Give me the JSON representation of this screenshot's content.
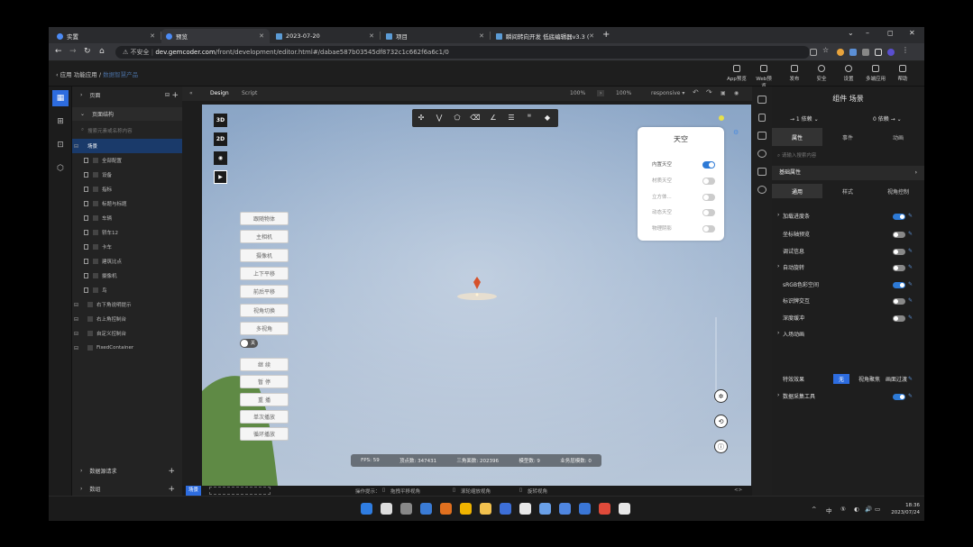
{
  "browser": {
    "tabs": [
      {
        "title": "实置",
        "fav": "#4c8bf5"
      },
      {
        "title": "预览",
        "fav": "#4c8bf5"
      },
      {
        "title": "2023-07-20",
        "fav": "#5b9bd5"
      },
      {
        "title": "项目",
        "fav": "#5b9bd5"
      },
      {
        "title": "瞬间转向开发 低底编辑器v3.3 (",
        "fav": "#5b9bd5"
      }
    ],
    "tab_close": "✕",
    "new_tab": "+",
    "window_controls": [
      "⌄",
      "–",
      "◻",
      "✕"
    ],
    "security_label": "不安全",
    "url_domain": "dev.gemcoder.com",
    "url_path": "/front/development/editor.html#/dabae587b03545df8732c1c662f6a6c1/0"
  },
  "app": {
    "breadcrumb_back": "‹ 应用",
    "breadcrumb_app": "功能应用",
    "breadcrumb_sep": "/",
    "breadcrumb_current": "数据智慧产品",
    "toolbar": [
      "App预览",
      "Web预览",
      "发布",
      "安全",
      "设置",
      "多端应用",
      "帮助"
    ]
  },
  "left_panel": {
    "page_label": "页面",
    "structure_label": "页面结构",
    "search_placeholder": "搜索元素或名称内容",
    "tree": [
      {
        "label": "场景",
        "selected": true,
        "kind": "root"
      },
      {
        "label": "全部配置",
        "selected": false,
        "kind": "doc"
      },
      {
        "label": "设备",
        "selected": false,
        "kind": "doc"
      },
      {
        "label": "指标",
        "selected": false,
        "kind": "doc"
      },
      {
        "label": "标题与标题",
        "selected": false,
        "kind": "doc"
      },
      {
        "label": "车辆",
        "selected": false,
        "kind": "doc"
      },
      {
        "label": "轿车12",
        "selected": false,
        "kind": "doc"
      },
      {
        "label": "卡车",
        "selected": false,
        "kind": "doc"
      },
      {
        "label": "建筑比点",
        "selected": false,
        "kind": "doc"
      },
      {
        "label": "摄像机",
        "selected": false,
        "kind": "doc"
      },
      {
        "label": "鸟",
        "selected": false,
        "kind": "doc"
      },
      {
        "label": "右下角说明提示",
        "selected": false,
        "kind": "group"
      },
      {
        "label": "右上角控制台",
        "selected": false,
        "kind": "group"
      },
      {
        "label": "自定义控制台",
        "selected": false,
        "kind": "group"
      },
      {
        "label": "FixedContainer",
        "selected": false,
        "kind": "group"
      }
    ],
    "data_source_label": "数据源请求",
    "bottom_label": "数组"
  },
  "canvas": {
    "tab_design": "Design",
    "tab_script": "Script",
    "zoom_a": "100%",
    "zoom_b": "100%",
    "responsive": "responsive ▾",
    "view_buttons": [
      "3D",
      "2D",
      "◉",
      "▶"
    ],
    "side_buttons_top": [
      "跟随物体",
      "主相机",
      "摄像机",
      "上下平移",
      "前后平移",
      "视角切换",
      "多视角"
    ],
    "toggle_label": "关",
    "side_buttons_bottom": [
      "继 续",
      "暂 停",
      "重 播",
      "单次播放",
      "循环播放"
    ],
    "sky_panel": {
      "title": "天空",
      "rows": [
        {
          "label": "内置天空",
          "on": true
        },
        {
          "label": "材质天空",
          "on": false
        },
        {
          "label": "立方体...",
          "on": false
        },
        {
          "label": "动态天空",
          "on": false
        },
        {
          "label": "物理阴影",
          "on": false
        }
      ]
    },
    "fps_stats": [
      "FPS: 59",
      "顶点数: 347431",
      "三角面数: 202396",
      "模型数: 9",
      "业务层模数: 0"
    ],
    "status_left": "场景",
    "status_tips_label": "操作提示：",
    "status_tips": [
      "拖拽平移视角",
      "滚轮缩放视角",
      "旋转视角"
    ],
    "colors": {
      "sky_top": "#8aa5c6",
      "sky_bottom": "#b7c6d8",
      "ground": "#5f8a45",
      "marker": "#d6512a"
    }
  },
  "right_panel": {
    "title": "组件 场景",
    "dropdown_a": "→ 1 依赖 ⌄",
    "dropdown_b": "0 依赖 → ⌄",
    "tabs": [
      "属性",
      "事件",
      "动画"
    ],
    "search_placeholder": "请输入搜索内容",
    "section": "基础属性",
    "subtabs": [
      "通用",
      "样式",
      "视角控制"
    ],
    "rows": [
      {
        "label": "加载进度条",
        "toggle": "on",
        "expand": true
      },
      {
        "label": "坐标轴预览",
        "toggle": "off",
        "expand": false
      },
      {
        "label": "调试信息",
        "toggle": "off",
        "expand": false
      },
      {
        "label": "自动旋转",
        "toggle": "off",
        "expand": true
      },
      {
        "label": "sRGB色彩空间",
        "toggle": "on",
        "expand": false
      },
      {
        "label": "标识牌交互",
        "toggle": "off",
        "expand": false
      },
      {
        "label": "深度缓冲",
        "toggle": "off",
        "expand": false
      },
      {
        "label": "入场动画",
        "toggle": "none",
        "expand": true
      }
    ],
    "effect_label": "特效效果",
    "effect_options": [
      "无",
      "视角聚焦",
      "画面过渡"
    ],
    "last_row": "数据采集工具"
  },
  "taskbar": {
    "apps": [
      "#2f7de1",
      "#dddddd",
      "#888888",
      "#3a7bd5",
      "#e0701f",
      "#f0b400",
      "#f2c14e",
      "#3d6fd8",
      "#e9e9e9",
      "#6aa0e8",
      "#4f86e0",
      "#3a76d6",
      "#e04a3a",
      "#e8e8e8"
    ],
    "tray": [
      "^",
      "中",
      "⑤",
      "◐",
      "🔊",
      "▭"
    ],
    "time": "18:36",
    "date": "2023/07/24"
  }
}
